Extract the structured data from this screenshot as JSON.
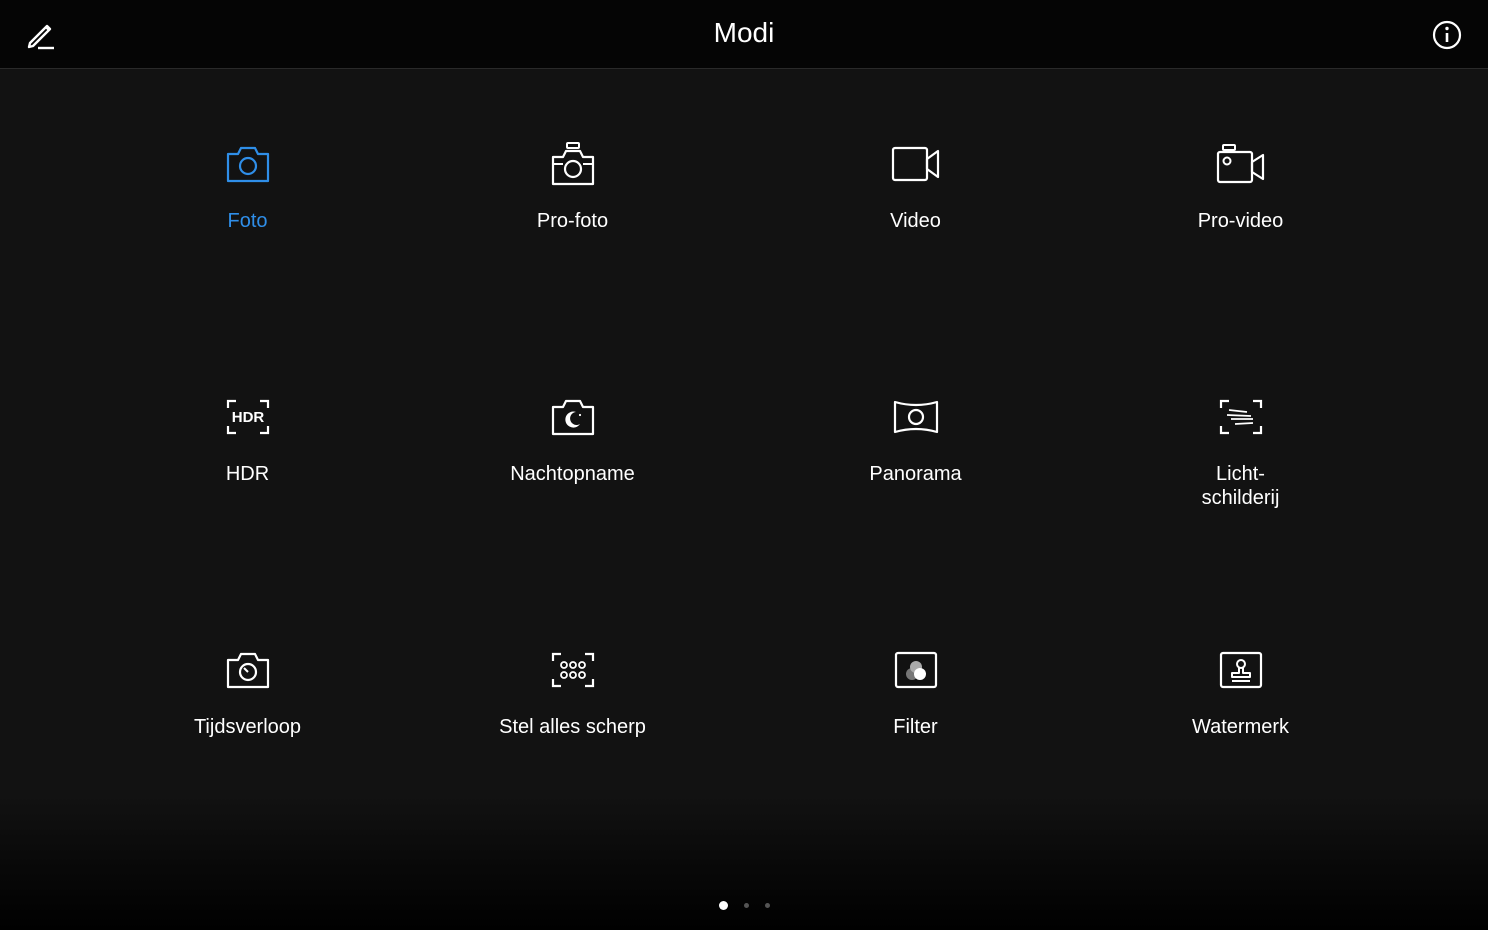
{
  "header": {
    "title": "Modi",
    "edit_icon": "pencil-icon",
    "info_icon": "info-icon"
  },
  "colors": {
    "accent": "#2f8ee8",
    "background": "#121212",
    "header_background": "#050505"
  },
  "modes": [
    {
      "label": "Foto",
      "icon": "camera-icon",
      "active": true
    },
    {
      "label": "Pro-foto",
      "icon": "pro-camera-icon",
      "active": false
    },
    {
      "label": "Video",
      "icon": "video-camera-icon",
      "active": false
    },
    {
      "label": "Pro-video",
      "icon": "pro-video-icon",
      "active": false
    },
    {
      "label": "HDR",
      "icon": "hdr-icon",
      "active": false,
      "icon_text": "HDR"
    },
    {
      "label": "Nachtopname",
      "icon": "night-camera-icon",
      "active": false
    },
    {
      "label": "Panorama",
      "icon": "panorama-icon",
      "active": false
    },
    {
      "label": "Licht-\nschilderij",
      "icon": "light-painting-icon",
      "active": false
    },
    {
      "label": "Tijdsverloop",
      "icon": "time-lapse-icon",
      "active": false
    },
    {
      "label": "Stel alles scherp",
      "icon": "all-focus-icon",
      "active": false
    },
    {
      "label": "Filter",
      "icon": "filter-icon",
      "active": false
    },
    {
      "label": "Watermerk",
      "icon": "watermark-icon",
      "active": false
    }
  ],
  "pagination": {
    "pages": 3,
    "current": 1
  }
}
